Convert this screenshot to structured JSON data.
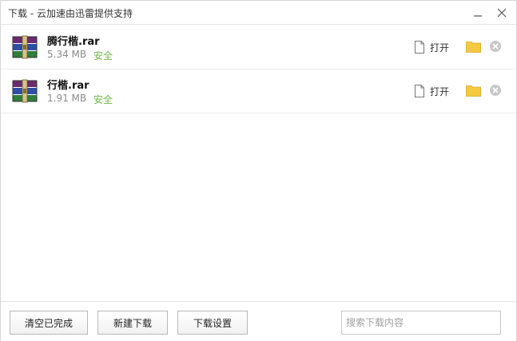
{
  "window": {
    "title": "下载 - 云加速由迅雷提供支持"
  },
  "downloads": [
    {
      "name": "腾行楷.rar",
      "size": "5.34 MB",
      "status": "安全",
      "open_label": "打开"
    },
    {
      "name": "行楷.rar",
      "size": "1.91 MB",
      "status": "安全",
      "open_label": "打开"
    }
  ],
  "toolbar": {
    "clear_label": "清空已完成",
    "new_label": "新建下载",
    "settings_label": "下载设置",
    "search_placeholder": "搜索下载内容"
  },
  "colors": {
    "safe": "#6db74a",
    "folder": "#f5c842",
    "border": "#d6d6d6"
  },
  "icons": [
    "minimize-icon",
    "close-icon",
    "winrar-archive-icon",
    "document-icon",
    "folder-icon",
    "remove-circle-icon"
  ]
}
